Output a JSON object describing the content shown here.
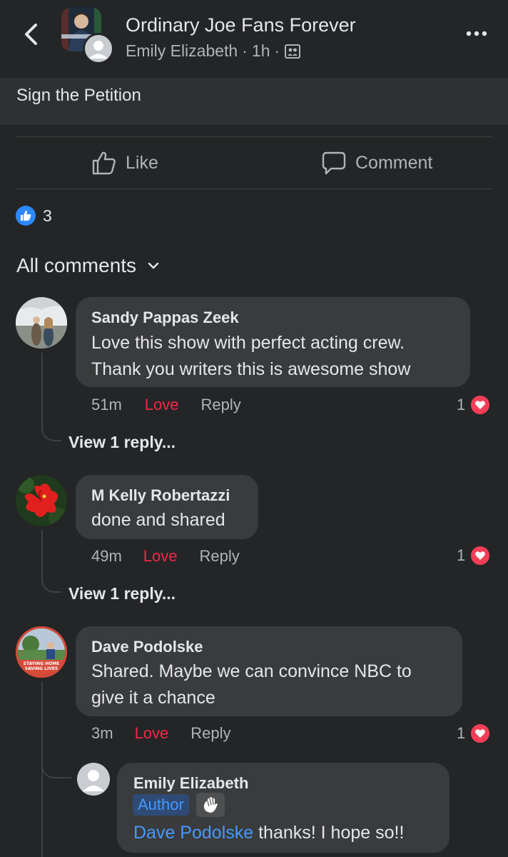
{
  "header": {
    "group_name": "Ordinary Joe Fans Forever",
    "author": "Emily Elizabeth",
    "time": "1h",
    "dot": "·"
  },
  "link_preview": {
    "title": "Sign the Petition"
  },
  "actions": {
    "like_label": "Like",
    "comment_label": "Comment"
  },
  "reactions": {
    "count": "3"
  },
  "comments_filter": {
    "label": "All comments"
  },
  "comments": [
    {
      "name": "Sandy Pappas Zeek",
      "text_line1": "Love this show with perfect  acting crew.",
      "text_line2": "Thank you writers this is awesome show",
      "time": "51m",
      "love": "Love",
      "reply": "Reply",
      "reaction_count": "1",
      "view_replies": "View 1 reply..."
    },
    {
      "name": "M Kelly Robertazzi",
      "text_line1": "done and shared",
      "time": "49m",
      "love": "Love",
      "reply": "Reply",
      "reaction_count": "1",
      "view_replies": "View 1 reply..."
    },
    {
      "name": "Dave Podolske",
      "text_line1": "Shared. Maybe we can convince NBC to",
      "text_line2": "give it a chance",
      "time": "3m",
      "love": "Love",
      "reply": "Reply",
      "reaction_count": "1",
      "avatar_caption_1": "STAYING HOME",
      "avatar_caption_2": "SAVING LIVES"
    }
  ],
  "reply": {
    "name": "Emily Elizabeth",
    "badge": "Author",
    "mention": "Dave Podolske",
    "text": " thanks! I hope so!!"
  },
  "colors": {
    "background": "#242526",
    "bubble": "#3a3b3c",
    "love": "#f02849",
    "link_blue": "#4599ff"
  }
}
